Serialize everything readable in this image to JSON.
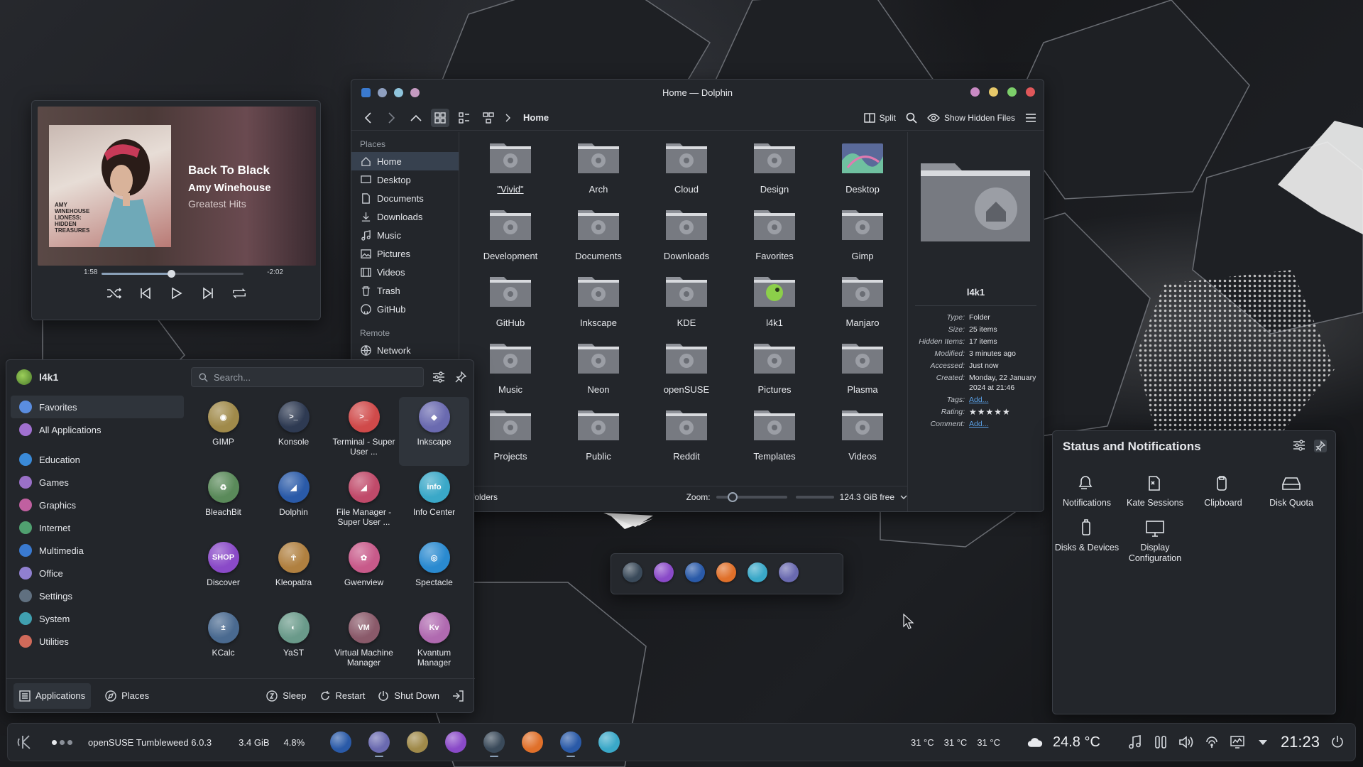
{
  "media_player": {
    "cover_text": "AMY WINEHOUSE LIONESS: HIDDEN TREASURES",
    "title": "Back To Black",
    "artist": "Amy Winehouse",
    "album": "Greatest Hits",
    "elapsed": "1:58",
    "remaining": "-2:02",
    "progress": 0.49
  },
  "dolphin": {
    "window_title": "Home — Dolphin",
    "breadcrumb": "Home",
    "split_label": "Split",
    "hidden_files_label": "Show Hidden Files",
    "places": {
      "section_places": "Places",
      "section_remote": "Remote",
      "items": [
        {
          "label": "Home",
          "icon": "home-icon"
        },
        {
          "label": "Desktop",
          "icon": "desktop-icon"
        },
        {
          "label": "Documents",
          "icon": "documents-icon"
        },
        {
          "label": "Downloads",
          "icon": "downloads-icon"
        },
        {
          "label": "Music",
          "icon": "music-icon"
        },
        {
          "label": "Pictures",
          "icon": "pictures-icon"
        },
        {
          "label": "Videos",
          "icon": "videos-icon"
        },
        {
          "label": "Trash",
          "icon": "trash-icon"
        },
        {
          "label": "GitHub",
          "icon": "github-icon"
        }
      ],
      "remote_items": [
        {
          "label": "Network",
          "icon": "network-icon"
        }
      ]
    },
    "folders": [
      "\"Vivid\"",
      "Arch",
      "Cloud",
      "Design",
      "Desktop",
      "Development",
      "Documents",
      "Downloads",
      "Favorites",
      "Gimp",
      "GitHub",
      "Inkscape",
      "KDE",
      "l4k1",
      "Manjaro",
      "Music",
      "Neon",
      "openSUSE",
      "Pictures",
      "Plasma",
      "Projects",
      "Public",
      "Reddit",
      "Templates",
      "Videos"
    ],
    "status_left": "folders",
    "zoom_label": "Zoom:",
    "free_space": "124.3 GiB free",
    "info": {
      "name": "l4k1",
      "rows": [
        {
          "k": "Type:",
          "v": "Folder"
        },
        {
          "k": "Size:",
          "v": "25 items"
        },
        {
          "k": "Hidden Items:",
          "v": "17 items"
        },
        {
          "k": "Modified:",
          "v": "3 minutes ago"
        },
        {
          "k": "Accessed:",
          "v": "Just now"
        },
        {
          "k": "Created:",
          "v": "Monday, 22 January 2024 at 21:46"
        },
        {
          "k": "Tags:",
          "v": "Add..."
        },
        {
          "k": "Rating:",
          "v": "★★★★★"
        },
        {
          "k": "Comment:",
          "v": "Add..."
        }
      ]
    }
  },
  "launcher": {
    "user": "l4k1",
    "search_placeholder": "Search...",
    "categories": [
      {
        "label": "Favorites",
        "color": "#5a8de0"
      },
      {
        "label": "All Applications",
        "color": "#a070d0"
      },
      {
        "label": "Education",
        "color": "#3a8ad8"
      },
      {
        "label": "Games",
        "color": "#9a70c8"
      },
      {
        "label": "Graphics",
        "color": "#c060a0"
      },
      {
        "label": "Internet",
        "color": "#50a070"
      },
      {
        "label": "Multimedia",
        "color": "#3a7ad0"
      },
      {
        "label": "Office",
        "color": "#9080d0"
      },
      {
        "label": "Settings",
        "color": "#607080"
      },
      {
        "label": "System",
        "color": "#40a0b0"
      },
      {
        "label": "Utilities",
        "color": "#d06a5a"
      }
    ],
    "apps": [
      {
        "label": "GIMP",
        "color": "#a08a4a",
        "glyph": "◉"
      },
      {
        "label": "Konsole",
        "color": "#2e3a52",
        "glyph": ">_"
      },
      {
        "label": "Terminal - Super User ...",
        "color": "#d04a4a",
        "glyph": ">_"
      },
      {
        "label": "Inkscape",
        "color": "#6a6ab0",
        "glyph": "◆"
      },
      {
        "label": "BleachBit",
        "color": "#5a8a5a",
        "glyph": "♻"
      },
      {
        "label": "Dolphin",
        "color": "#2a5aa8",
        "glyph": "◢"
      },
      {
        "label": "File Manager - Super User ...",
        "color": "#c04a6a",
        "glyph": "◢"
      },
      {
        "label": "Info Center",
        "color": "#3aa8c8",
        "glyph": "info"
      },
      {
        "label": "Discover",
        "color": "#8a4ac8",
        "glyph": "SHOP"
      },
      {
        "label": "Kleopatra",
        "color": "#b08040",
        "glyph": "☥"
      },
      {
        "label": "Gwenview",
        "color": "#c85a8a",
        "glyph": "✿"
      },
      {
        "label": "Spectacle",
        "color": "#2a8ad0",
        "glyph": "◎"
      },
      {
        "label": "KCalc",
        "color": "#4a6a90",
        "glyph": "±"
      },
      {
        "label": "YaST",
        "color": "#6a9a8a",
        "glyph": "◐"
      },
      {
        "label": "Virtual Machine Manager",
        "color": "#8a5a6a",
        "glyph": "VM"
      },
      {
        "label": "Kvantum Manager",
        "color": "#b06ab0",
        "glyph": "Kv"
      }
    ],
    "footer": {
      "applications": "Applications",
      "places": "Places",
      "sleep": "Sleep",
      "restart": "Restart",
      "shutdown": "Shut Down"
    }
  },
  "notifications": {
    "title": "Status and Notifications",
    "items": [
      {
        "label": "Notifications",
        "icon": "bell-icon"
      },
      {
        "label": "Kate Sessions",
        "icon": "kate-icon"
      },
      {
        "label": "Clipboard",
        "icon": "clipboard-icon"
      },
      {
        "label": "Disk Quota",
        "icon": "disk-quota-icon"
      },
      {
        "label": "Disks & Devices",
        "icon": "disks-icon"
      },
      {
        "label": "Display Configuration",
        "icon": "display-icon"
      }
    ]
  },
  "dock_colors": [
    "#3a4a5a",
    "#8a4ac8",
    "#2a5aa8",
    "#e0702a",
    "#3aa8c8",
    "#6a6ab0"
  ],
  "taskbar": {
    "os_label": "openSUSE Tumbleweed 6.0.3",
    "memory": "3.4 GiB",
    "cpu": "4.8%",
    "temps": [
      "31 °C",
      "31 °C",
      "31 °C"
    ],
    "weather": "24.8 °C",
    "clock": "21:23",
    "app_colors": [
      "#2a5aa8",
      "#6a6ab0",
      "#a08a4a",
      "#8a4ac8",
      "#3a4a5a",
      "#e0702a",
      "#2a5aa8",
      "#3aa8c8"
    ]
  }
}
